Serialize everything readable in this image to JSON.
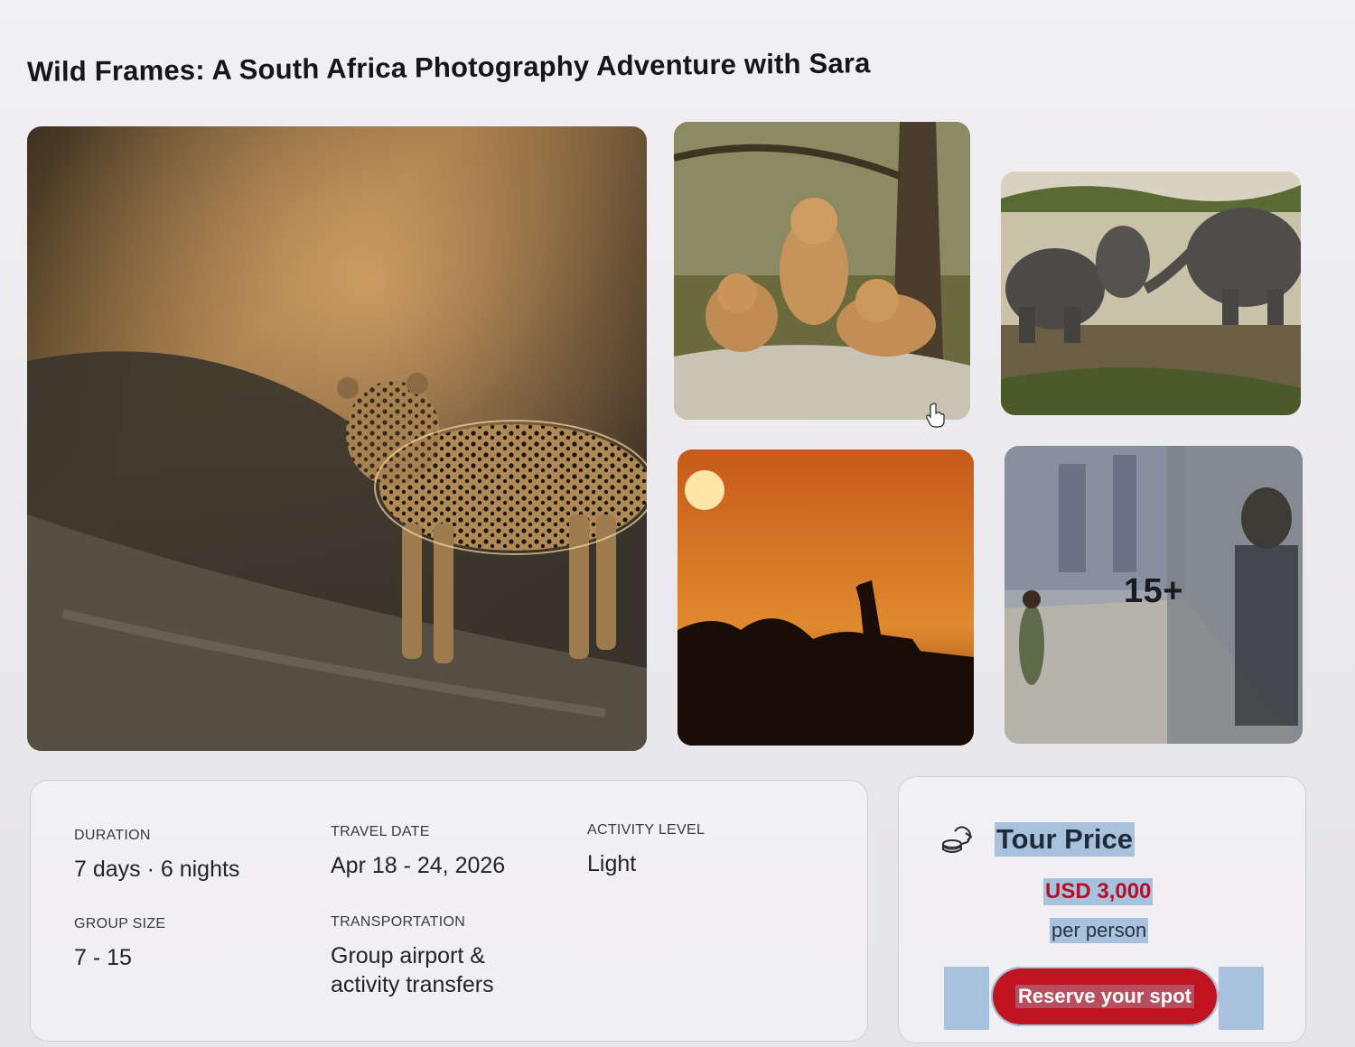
{
  "tour": {
    "title": "Wild Frames: A South Africa Photography Adventure with Sara"
  },
  "gallery": {
    "photos": [
      {
        "subject": "leopard"
      },
      {
        "subject": "lion-cubs"
      },
      {
        "subject": "elephants"
      },
      {
        "subject": "giraffe-sunset"
      },
      {
        "subject": "city-street-mural"
      }
    ],
    "more_count": "15+"
  },
  "details": {
    "duration": {
      "label": "DURATION",
      "value": "7 days · 6 nights"
    },
    "travel_date": {
      "label": "TRAVEL DATE",
      "value": "Apr 18 - 24, 2026"
    },
    "activity_level": {
      "label": "ACTIVITY LEVEL",
      "value": "Light"
    },
    "group_size": {
      "label": "GROUP SIZE",
      "value": "7 - 15"
    },
    "transportation": {
      "label": "TRANSPORTATION",
      "value": "Group airport & activity transfers"
    }
  },
  "pricing": {
    "icon": "coins-icon",
    "title": "Tour Price",
    "amount": "USD 3,000",
    "unit": "per person",
    "cta_label": "Reserve your spot"
  },
  "colors": {
    "accent": "#c1121f",
    "selection": "#a8c2dd",
    "price_text": "#b5102a"
  }
}
